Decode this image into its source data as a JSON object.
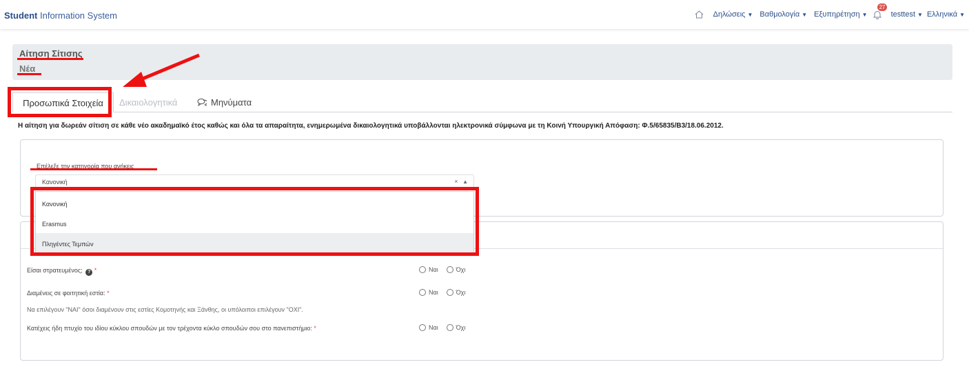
{
  "brand": {
    "bold": "Student",
    "rest": " Information System"
  },
  "nav": {
    "items": [
      "Δηλώσεις",
      "Βαθμολογία",
      "Εξυπηρέτηση"
    ],
    "notifications": "27",
    "user": "testtest",
    "language": "Ελληνικά"
  },
  "header": {
    "title": "Αίτηση Σίτισης",
    "subtitle": "Νέα"
  },
  "tabs": [
    {
      "label": "Προσωπικά Στοιχεία",
      "state": "active"
    },
    {
      "label": "Δικαιολογητικά",
      "state": "disabled"
    },
    {
      "label": "Μηνύματα",
      "state": "normal"
    }
  ],
  "notice": "Η αίτηση για δωρεάν σίτιση σε κάθε νέο ακαδημαϊκό έτος καθώς και όλα τα απαραίτητα, ενημερωμένα δικαιολογητικά υποβάλλονται ηλεκτρονικά σύμφωνα με τη Κοινή Υπουργική Απόφαση: Φ.5/65835/Β3/18.06.2012.",
  "category": {
    "label": "Επέλεξε την κατηγορία που ανήκεις",
    "selected": "Κανονική",
    "clear": "×",
    "options": [
      "Κανονική",
      "Erasmus",
      "Πληγέντες Τεμπών"
    ],
    "highlighted_index": 2
  },
  "questions": {
    "q1": "Είσαι στρατευμένος;",
    "q2": "Διαμένεις σε φοιτητική εστία:",
    "q2_hint": "Να επιλέγουν \"ΝΑΙ\" όσοι διαμένουν στις εστίες Κομοτηνής και Ξάνθης, οι υπόλοιποι επιλέγουν \"ΟΧΙ\".",
    "q3": "Κατέχεις ήδη πτυχίο του ιδίου κύκλου σπουδών με τον τρέχοντα κύκλο σπουδών σου στο πανεπιστήμιο:",
    "required_mark": "*",
    "help_glyph": "?",
    "yes": "Ναι",
    "no": "Όχι"
  },
  "colors": {
    "brand": "#2c4f8c",
    "annotation": "#ee1111",
    "badge": "#d9534f"
  }
}
